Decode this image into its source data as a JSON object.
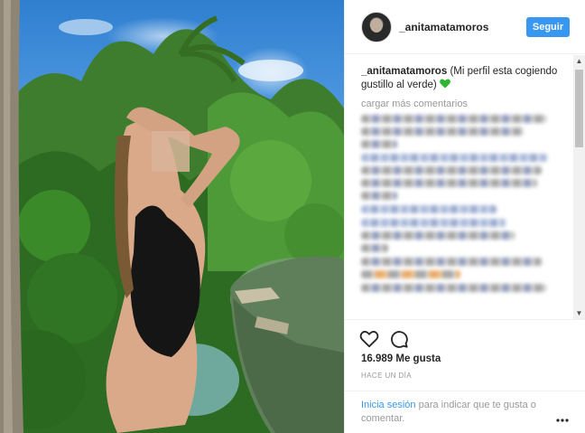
{
  "post": {
    "username": "_anitamatamoros",
    "follow_label": "Seguir",
    "caption_user": "_anitamatamoros",
    "caption_text": "(Mi perfil esta cogiendo gustillo al verde)",
    "load_more": "cargar más comentarios",
    "likes": "16.989 Me gusta",
    "time": "HACE UN DÍA",
    "login_link": "Inicia sesión",
    "login_rest": " para indicar que te gusta o comentar."
  },
  "icons": {
    "like": "heart-outline-icon",
    "comment": "speech-bubble-icon",
    "more": "ellipsis-icon",
    "caption_emoji": "green-heart-icon"
  },
  "colors": {
    "accent": "#3897f0",
    "text": "#262626",
    "muted": "#999999",
    "emoji_green": "#2fb52f"
  }
}
